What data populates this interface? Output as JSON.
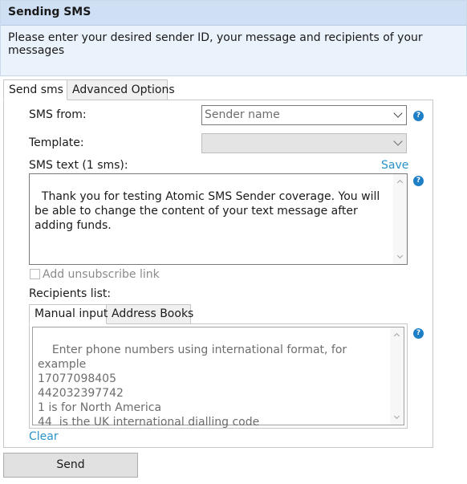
{
  "header": {
    "title": "Sending SMS",
    "description": "Please enter your desired sender ID, your message and recipients of your messages"
  },
  "tabs": [
    {
      "label": "Send sms",
      "active": true
    },
    {
      "label": "Advanced Options",
      "active": false
    }
  ],
  "form": {
    "sms_from_label": "SMS from:",
    "sender_select_value": "Sender name",
    "template_label": "Template:",
    "template_value": "",
    "sms_text_label": "SMS text (1 sms):",
    "save_link": "Save",
    "sms_text_value": "Thank you for testing Atomic SMS Sender coverage. You will be able to change the content of your text message after adding funds.",
    "unsubscribe_label": "Add unsubscribe link",
    "unsubscribe_checked": false,
    "unsubscribe_disabled": true,
    "recipients_label": "Recipients list:",
    "recipient_tabs": [
      {
        "label": "Manual input",
        "active": true
      },
      {
        "label": "Address Books",
        "active": false
      }
    ],
    "recipients_placeholder": "Enter phone numbers using international format, for example\n17077098405\n442032397742\n1 is for North America\n44  is the UK international dialling code",
    "clear_link": "Clear"
  },
  "help_icon_glyph": "?",
  "send_button": "Send",
  "colors": {
    "header_bg": "#eaf2fb",
    "title_bg": "#cfe0f4",
    "link": "#2a93c9",
    "help_icon": "#1e7fc7",
    "button_bg": "#e1e1e1"
  },
  "icons": [
    "help-icon",
    "chevron-down-icon"
  ]
}
